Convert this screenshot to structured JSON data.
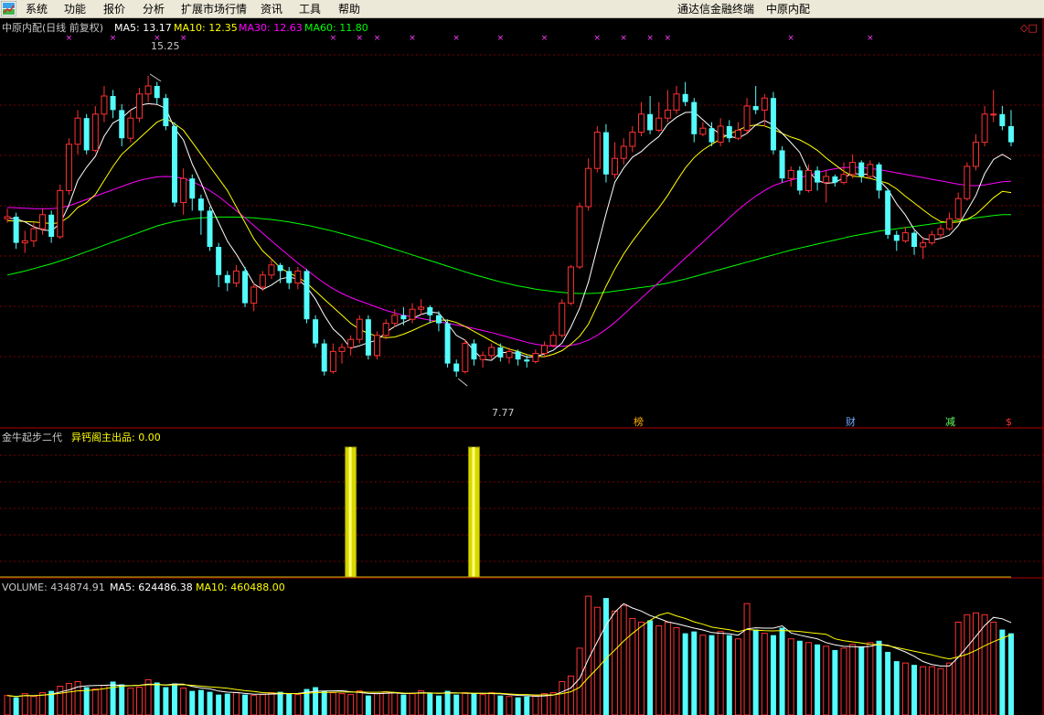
{
  "menu": {
    "items": [
      "系统",
      "功能",
      "报价",
      "分析",
      "扩展市场行情",
      "资讯",
      "工具",
      "帮助"
    ],
    "right_title": "通达信金融终端",
    "right_stock": "中原内配"
  },
  "price_panel": {
    "title": "中原内配(日线 前复权)",
    "ma5_label": "MA5: 13.17",
    "ma10_label": "MA10: 12.35",
    "ma30_label": "MA30: 12.63",
    "ma60_label": "MA60: 11.80",
    "high_label": "15.25",
    "low_label": "7.77",
    "markers": [
      "榜",
      "财",
      "减",
      "$"
    ],
    "corner_symbol": "◇□"
  },
  "indicator_panel": {
    "name": "金牛起步二代",
    "signal_label": "异钙阁主出品: 0.00"
  },
  "volume_panel": {
    "vol_label": "VOLUME: 434874.91",
    "ma5_label": "MA5: 624486.38",
    "ma10_label": "MA10: 460488.00"
  },
  "colors": {
    "up": "#ff3232",
    "down": "#54fcfc",
    "ma5": "#ffffff",
    "ma10": "#ffff00",
    "ma30": "#ff00ff",
    "ma60": "#00ff00",
    "grid": "#7a0000",
    "panel_border": "#b00000",
    "signal_bar": "#d8d800"
  },
  "chart_data": {
    "type": "candlestick",
    "price_range": [
      7.0,
      16.0
    ],
    "candles": [
      [
        11.7,
        11.75,
        11.95,
        11.6
      ],
      [
        11.75,
        11.1,
        11.85,
        10.95
      ],
      [
        11.1,
        11.15,
        11.4,
        10.85
      ],
      [
        11.15,
        11.45,
        11.6,
        11.0
      ],
      [
        11.45,
        11.8,
        11.95,
        11.3
      ],
      [
        11.8,
        11.25,
        11.9,
        11.1
      ],
      [
        11.25,
        12.4,
        12.55,
        11.2
      ],
      [
        12.4,
        13.55,
        13.7,
        12.3
      ],
      [
        13.55,
        14.2,
        14.4,
        13.3
      ],
      [
        14.2,
        13.4,
        14.3,
        13.3
      ],
      [
        13.4,
        14.3,
        14.5,
        13.35
      ],
      [
        14.3,
        14.75,
        15.0,
        14.1
      ],
      [
        14.75,
        14.4,
        14.9,
        14.2
      ],
      [
        14.4,
        13.7,
        14.55,
        13.5
      ],
      [
        13.7,
        14.2,
        14.4,
        13.6
      ],
      [
        14.2,
        14.8,
        14.95,
        14.1
      ],
      [
        14.8,
        15.0,
        15.25,
        14.6
      ],
      [
        15.0,
        14.7,
        15.1,
        14.55
      ],
      [
        14.7,
        14.0,
        14.8,
        13.9
      ],
      [
        14.0,
        12.1,
        14.1,
        12.0
      ],
      [
        12.1,
        12.7,
        12.95,
        11.8
      ],
      [
        12.7,
        12.2,
        12.8,
        11.9
      ],
      [
        12.2,
        11.9,
        12.3,
        11.3
      ],
      [
        11.9,
        11.0,
        12.0,
        10.9
      ],
      [
        11.0,
        10.3,
        11.1,
        10.0
      ],
      [
        10.3,
        10.1,
        10.4,
        9.9
      ],
      [
        10.1,
        10.4,
        10.55,
        10.0
      ],
      [
        10.4,
        9.6,
        10.5,
        9.5
      ],
      [
        9.6,
        10.0,
        10.1,
        9.4
      ],
      [
        10.0,
        10.3,
        10.4,
        9.9
      ],
      [
        10.3,
        10.55,
        10.7,
        10.2
      ],
      [
        10.55,
        10.4,
        10.6,
        10.1
      ],
      [
        10.4,
        10.1,
        10.5,
        9.95
      ],
      [
        10.1,
        10.4,
        10.5,
        9.95
      ],
      [
        10.4,
        9.2,
        10.45,
        9.1
      ],
      [
        9.2,
        8.6,
        9.3,
        8.5
      ],
      [
        8.6,
        7.9,
        8.7,
        7.8
      ],
      [
        7.9,
        8.4,
        8.6,
        7.85
      ],
      [
        8.4,
        8.5,
        8.6,
        8.1
      ],
      [
        8.5,
        8.7,
        8.8,
        8.3
      ],
      [
        8.7,
        9.2,
        9.3,
        8.6
      ],
      [
        9.2,
        8.3,
        9.3,
        8.2
      ],
      [
        8.3,
        8.8,
        8.9,
        8.2
      ],
      [
        8.8,
        9.1,
        9.2,
        8.7
      ],
      [
        9.1,
        9.3,
        9.45,
        9.0
      ],
      [
        9.3,
        9.2,
        9.5,
        9.05
      ],
      [
        9.2,
        9.45,
        9.6,
        9.1
      ],
      [
        9.45,
        9.5,
        9.7,
        9.3
      ],
      [
        9.5,
        9.3,
        9.55,
        9.1
      ],
      [
        9.3,
        9.1,
        9.4,
        8.9
      ],
      [
        9.1,
        8.1,
        9.2,
        8.0
      ],
      [
        8.1,
        7.9,
        8.2,
        7.77
      ],
      [
        7.9,
        8.6,
        8.7,
        7.85
      ],
      [
        8.6,
        8.2,
        8.7,
        8.05
      ],
      [
        8.2,
        8.3,
        8.4,
        8.0
      ],
      [
        8.3,
        8.5,
        8.6,
        8.2
      ],
      [
        8.5,
        8.25,
        8.6,
        8.15
      ],
      [
        8.25,
        8.4,
        8.5,
        8.1
      ],
      [
        8.4,
        8.2,
        8.45,
        8.05
      ],
      [
        8.2,
        8.15,
        8.3,
        8.0
      ],
      [
        8.15,
        8.35,
        8.45,
        8.1
      ],
      [
        8.35,
        8.55,
        8.65,
        8.25
      ],
      [
        8.55,
        8.8,
        8.9,
        8.5
      ],
      [
        8.8,
        9.6,
        9.7,
        8.75
      ],
      [
        9.6,
        10.5,
        10.55,
        9.55
      ],
      [
        10.5,
        12.0,
        12.1,
        10.45
      ],
      [
        12.0,
        12.95,
        13.2,
        11.9
      ],
      [
        12.95,
        13.85,
        14.0,
        12.85
      ],
      [
        13.85,
        12.8,
        14.05,
        12.6
      ],
      [
        12.8,
        13.2,
        13.6,
        12.7
      ],
      [
        13.2,
        13.5,
        13.7,
        13.05
      ],
      [
        13.5,
        13.85,
        14.0,
        13.35
      ],
      [
        13.85,
        14.3,
        14.6,
        13.75
      ],
      [
        14.3,
        13.9,
        14.75,
        13.8
      ],
      [
        13.9,
        14.2,
        14.6,
        13.85
      ],
      [
        14.2,
        14.4,
        14.9,
        14.1
      ],
      [
        14.4,
        14.8,
        15.0,
        14.3
      ],
      [
        14.8,
        14.6,
        15.1,
        14.5
      ],
      [
        14.6,
        13.8,
        14.7,
        13.6
      ],
      [
        13.8,
        13.95,
        14.1,
        13.75
      ],
      [
        13.95,
        13.6,
        14.1,
        13.5
      ],
      [
        13.6,
        14.0,
        14.2,
        13.5
      ],
      [
        14.0,
        13.7,
        14.15,
        13.6
      ],
      [
        13.7,
        13.9,
        14.1,
        13.65
      ],
      [
        13.9,
        14.5,
        14.7,
        13.8
      ],
      [
        14.5,
        14.4,
        15.0,
        14.3
      ],
      [
        14.4,
        14.7,
        14.8,
        14.0
      ],
      [
        14.7,
        13.4,
        14.85,
        13.3
      ],
      [
        13.4,
        12.7,
        13.5,
        12.6
      ],
      [
        12.7,
        12.9,
        13.0,
        12.5
      ],
      [
        12.9,
        12.4,
        13.0,
        12.3
      ],
      [
        12.4,
        12.9,
        13.05,
        12.35
      ],
      [
        12.9,
        12.6,
        13.0,
        12.4
      ],
      [
        12.6,
        12.75,
        12.9,
        12.1
      ],
      [
        12.75,
        12.6,
        12.8,
        12.5
      ],
      [
        12.6,
        12.8,
        13.1,
        12.55
      ],
      [
        12.8,
        13.1,
        13.3,
        12.7
      ],
      [
        13.1,
        12.75,
        13.15,
        12.6
      ],
      [
        12.75,
        13.05,
        13.15,
        12.7
      ],
      [
        13.05,
        12.4,
        13.1,
        12.2
      ],
      [
        12.4,
        11.3,
        12.45,
        11.2
      ],
      [
        11.3,
        11.15,
        11.4,
        10.9
      ],
      [
        11.15,
        11.35,
        11.5,
        11.1
      ],
      [
        11.35,
        11.0,
        11.4,
        10.8
      ],
      [
        11.0,
        11.1,
        11.25,
        10.7
      ],
      [
        11.1,
        11.3,
        11.4,
        11.05
      ],
      [
        11.3,
        11.45,
        11.55,
        11.2
      ],
      [
        11.45,
        11.7,
        11.85,
        11.4
      ],
      [
        11.7,
        12.2,
        12.35,
        11.65
      ],
      [
        12.2,
        13.0,
        13.1,
        12.15
      ],
      [
        13.0,
        13.6,
        13.8,
        12.9
      ],
      [
        13.6,
        14.3,
        14.5,
        13.5
      ],
      [
        14.3,
        14.3,
        14.9,
        14.1
      ],
      [
        14.3,
        14.0,
        14.5,
        13.9
      ],
      [
        14.0,
        13.6,
        14.4,
        13.5
      ]
    ],
    "ma5": [
      11.71,
      11.7,
      11.62,
      11.5,
      11.42,
      11.4,
      11.58,
      12.04,
      12.65,
      12.98,
      13.25,
      13.75,
      14.08,
      14.2,
      14.4,
      14.52,
      14.56,
      14.54,
      14.44,
      13.94,
      13.66,
      13.06,
      12.6,
      12.06,
      11.6,
      11.14,
      10.82,
      10.46,
      10.08,
      9.94,
      10.05,
      10.2,
      10.25,
      10.2,
      10.0,
      9.7,
      9.3,
      8.96,
      8.76,
      8.48,
      8.54,
      8.62,
      8.68,
      8.88,
      9.02,
      9.12,
      9.22,
      9.32,
      9.38,
      9.36,
      9.09,
      8.8,
      8.68,
      8.42,
      8.2,
      8.18,
      8.37,
      8.38,
      8.35,
      8.26,
      8.27,
      8.34,
      8.43,
      8.61,
      9.0,
      9.48,
      10.13,
      10.98,
      11.82,
      12.61,
      12.96,
      13.23,
      13.37,
      13.57,
      13.74,
      14.05,
      14.22,
      14.34,
      14.35,
      14.16,
      13.96,
      13.79,
      13.75,
      13.7,
      13.82,
      14.03,
      14.14,
      14.03,
      13.82,
      13.59,
      13.35,
      12.87,
      12.65,
      12.58,
      12.6,
      12.72,
      12.83,
      12.8,
      12.81,
      12.66,
      12.43,
      12.07,
      11.79,
      11.43,
      11.21,
      11.17,
      11.21,
      11.29,
      11.53,
      11.9,
      12.28,
      12.82,
      13.17,
      13.3,
      13.17
    ],
    "ma10": [
      11.65,
      11.64,
      11.63,
      11.62,
      11.6,
      11.58,
      11.6,
      11.75,
      11.98,
      12.1,
      12.3,
      12.65,
      13.0,
      13.3,
      13.5,
      13.7,
      13.9,
      14.1,
      14.2,
      14.06,
      13.9,
      13.6,
      13.3,
      13.0,
      12.7,
      12.4,
      12.0,
      11.6,
      11.2,
      10.9,
      10.7,
      10.48,
      10.35,
      10.25,
      10.1,
      9.9,
      9.7,
      9.5,
      9.3,
      9.1,
      8.95,
      8.85,
      8.78,
      8.74,
      8.76,
      8.83,
      8.92,
      9.02,
      9.12,
      9.18,
      9.18,
      9.12,
      9.02,
      8.9,
      8.78,
      8.66,
      8.54,
      8.46,
      8.4,
      8.32,
      8.28,
      8.27,
      8.33,
      8.42,
      8.58,
      8.78,
      9.08,
      9.54,
      10.02,
      10.45,
      10.82,
      11.14,
      11.43,
      11.71,
      11.97,
      12.28,
      12.63,
      12.96,
      13.22,
      13.41,
      13.55,
      13.68,
      13.81,
      13.9,
      14.0,
      14.03,
      14.01,
      13.92,
      13.82,
      13.73,
      13.66,
      13.54,
      13.4,
      13.21,
      13.04,
      12.88,
      12.76,
      12.74,
      12.7,
      12.64,
      12.58,
      12.44,
      12.26,
      12.09,
      11.92,
      11.76,
      11.63,
      11.6,
      11.62,
      11.68,
      11.81,
      12.01,
      12.22,
      12.38,
      12.35
    ],
    "ma30": [
      11.98,
      11.97,
      11.96,
      11.95,
      11.95,
      11.95,
      11.97,
      12.02,
      12.1,
      12.18,
      12.26,
      12.34,
      12.42,
      12.5,
      12.58,
      12.65,
      12.7,
      12.74,
      12.75,
      12.74,
      12.7,
      12.62,
      12.52,
      12.4,
      12.25,
      12.08,
      11.9,
      11.72,
      11.53,
      11.34,
      11.15,
      10.96,
      10.78,
      10.6,
      10.43,
      10.26,
      10.1,
      9.96,
      9.84,
      9.74,
      9.66,
      9.58,
      9.5,
      9.42,
      9.36,
      9.3,
      9.26,
      9.22,
      9.18,
      9.14,
      9.1,
      9.06,
      9.02,
      8.97,
      8.92,
      8.87,
      8.81,
      8.75,
      8.69,
      8.63,
      8.58,
      8.55,
      8.53,
      8.53,
      8.55,
      8.6,
      8.68,
      8.8,
      8.95,
      9.12,
      9.32,
      9.52,
      9.72,
      9.92,
      10.12,
      10.32,
      10.52,
      10.72,
      10.92,
      11.12,
      11.32,
      11.52,
      11.72,
      11.92,
      12.1,
      12.26,
      12.4,
      12.52,
      12.6,
      12.66,
      12.72,
      12.78,
      12.84,
      12.9,
      12.94,
      12.97,
      12.98,
      12.97,
      12.95,
      12.92,
      12.88,
      12.84,
      12.8,
      12.76,
      12.72,
      12.68,
      12.64,
      12.6,
      12.56,
      12.53,
      12.52,
      12.54,
      12.58,
      12.62,
      12.63
    ],
    "ma60": [
      10.3,
      10.35,
      10.4,
      10.46,
      10.52,
      10.58,
      10.65,
      10.72,
      10.8,
      10.88,
      10.96,
      11.04,
      11.12,
      11.2,
      11.28,
      11.36,
      11.44,
      11.52,
      11.58,
      11.63,
      11.67,
      11.7,
      11.72,
      11.73,
      11.74,
      11.74,
      11.74,
      11.73,
      11.72,
      11.7,
      11.68,
      11.65,
      11.62,
      11.58,
      11.54,
      11.49,
      11.44,
      11.39,
      11.33,
      11.27,
      11.21,
      11.15,
      11.08,
      11.01,
      10.94,
      10.87,
      10.8,
      10.73,
      10.66,
      10.59,
      10.52,
      10.45,
      10.38,
      10.31,
      10.25,
      10.19,
      10.13,
      10.08,
      10.03,
      9.99,
      9.95,
      9.92,
      9.89,
      9.87,
      9.85,
      9.84,
      9.84,
      9.85,
      9.87,
      9.9,
      9.93,
      9.96,
      9.99,
      10.02,
      10.06,
      10.1,
      10.15,
      10.2,
      10.26,
      10.32,
      10.38,
      10.44,
      10.5,
      10.56,
      10.62,
      10.68,
      10.74,
      10.8,
      10.86,
      10.92,
      10.97,
      11.02,
      11.07,
      11.12,
      11.17,
      11.22,
      11.27,
      11.31,
      11.35,
      11.39,
      11.42,
      11.45,
      11.48,
      11.51,
      11.54,
      11.57,
      11.6,
      11.63,
      11.66,
      11.69,
      11.72,
      11.75,
      11.78,
      11.8,
      11.8
    ],
    "signal_bars": [
      39,
      53
    ],
    "volume": [
      210,
      190,
      230,
      200,
      240,
      260,
      310,
      340,
      360,
      300,
      280,
      320,
      360,
      330,
      290,
      300,
      380,
      350,
      300,
      340,
      290,
      260,
      270,
      250,
      220,
      230,
      240,
      220,
      210,
      220,
      240,
      250,
      230,
      220,
      280,
      300,
      260,
      240,
      230,
      220,
      260,
      210,
      230,
      250,
      240,
      220,
      230,
      260,
      240,
      210,
      260,
      220,
      240,
      230,
      220,
      240,
      210,
      200,
      190,
      200,
      210,
      230,
      240,
      360,
      420,
      720,
      1280,
      1160,
      1260,
      1120,
      1180,
      1040,
      1000,
      1020,
      960,
      1000,
      940,
      880,
      900,
      860,
      860,
      900,
      860,
      820,
      1200,
      920,
      880,
      860,
      940,
      820,
      800,
      780,
      760,
      740,
      700,
      720,
      760,
      740,
      780,
      800,
      680,
      580,
      560,
      540,
      520,
      520,
      500,
      560,
      1000,
      1080,
      1100,
      1080,
      1000,
      920,
      880
    ]
  }
}
